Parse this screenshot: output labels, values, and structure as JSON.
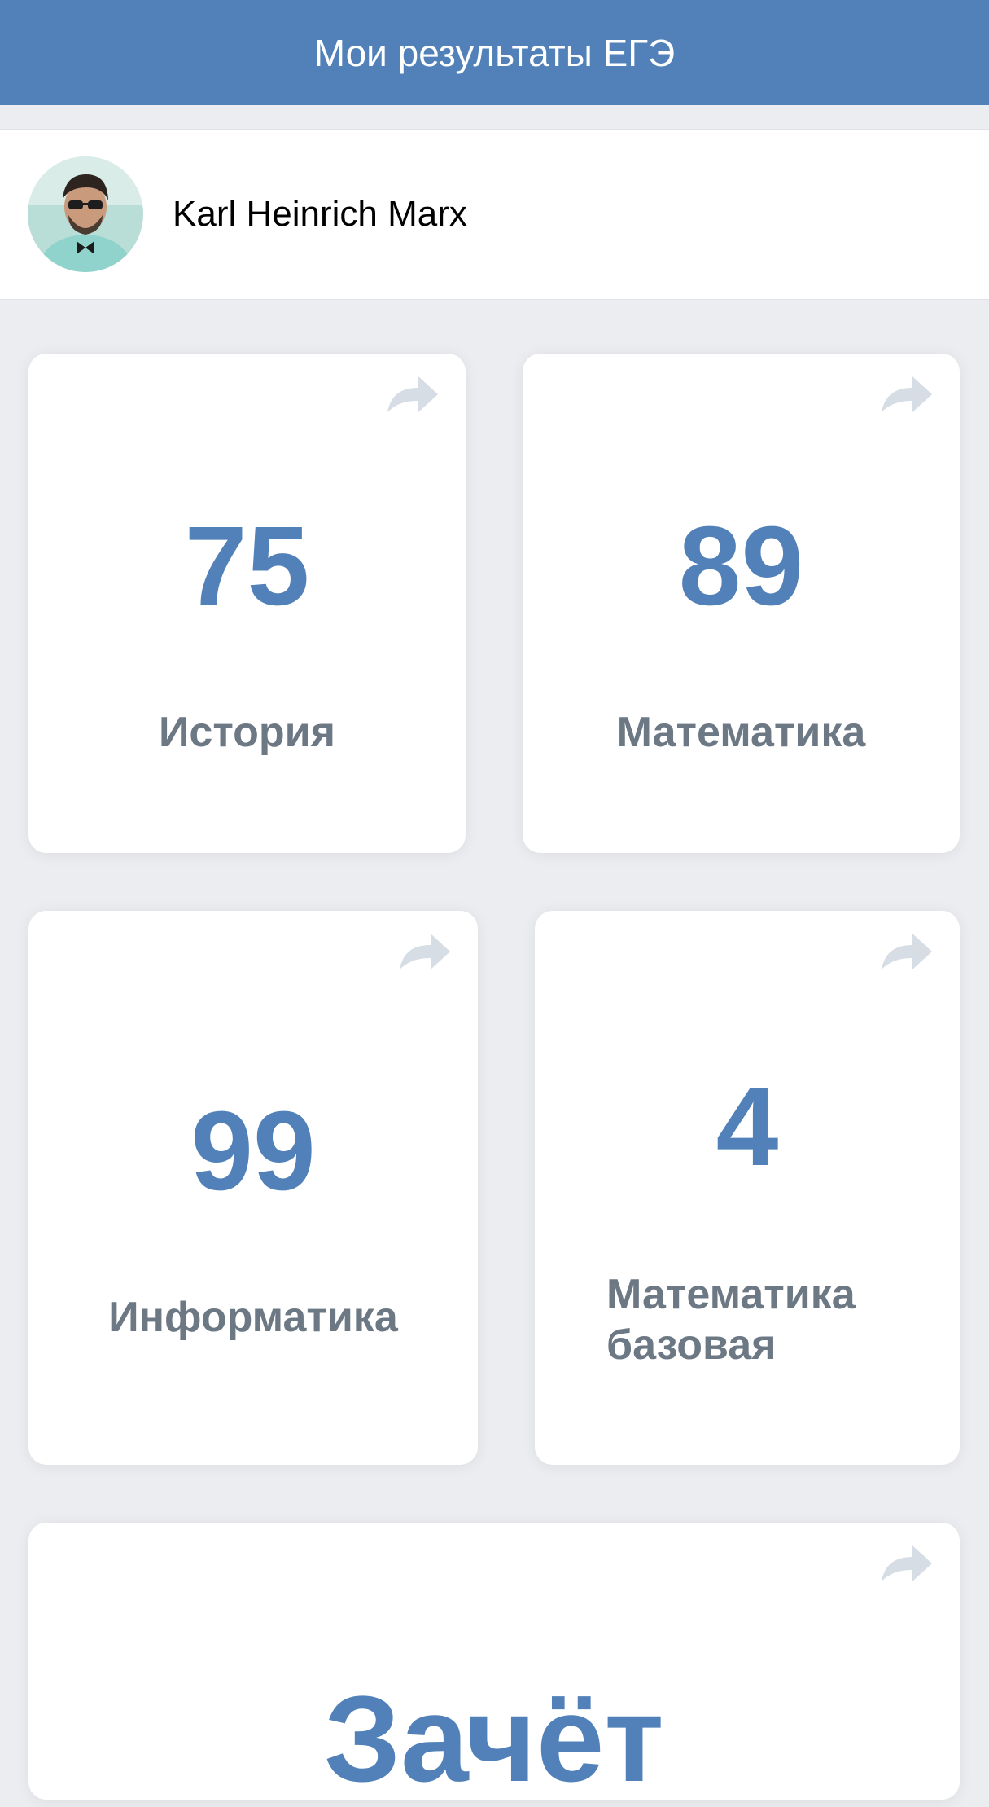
{
  "header": {
    "title": "Мои результаты ЕГЭ"
  },
  "profile": {
    "name": "Karl Heinrich Marx",
    "avatar_icon": "user-avatar-photo"
  },
  "cards": [
    {
      "score": "75",
      "subject": "История",
      "share_icon": "share-arrow-icon"
    },
    {
      "score": "89",
      "subject": "Математика",
      "share_icon": "share-arrow-icon"
    },
    {
      "score": "99",
      "subject": "Информатика",
      "share_icon": "share-arrow-icon"
    },
    {
      "score": "4",
      "subject": "Математика базовая",
      "share_icon": "share-arrow-icon"
    },
    {
      "score": "Зачёт",
      "subject": "",
      "share_icon": "share-arrow-icon"
    }
  ],
  "colors": {
    "header_bg": "#5181b8",
    "score": "#5181b8",
    "subject": "#6d7885",
    "page_bg": "#ebedf0",
    "share_icon": "#d6dde4"
  }
}
